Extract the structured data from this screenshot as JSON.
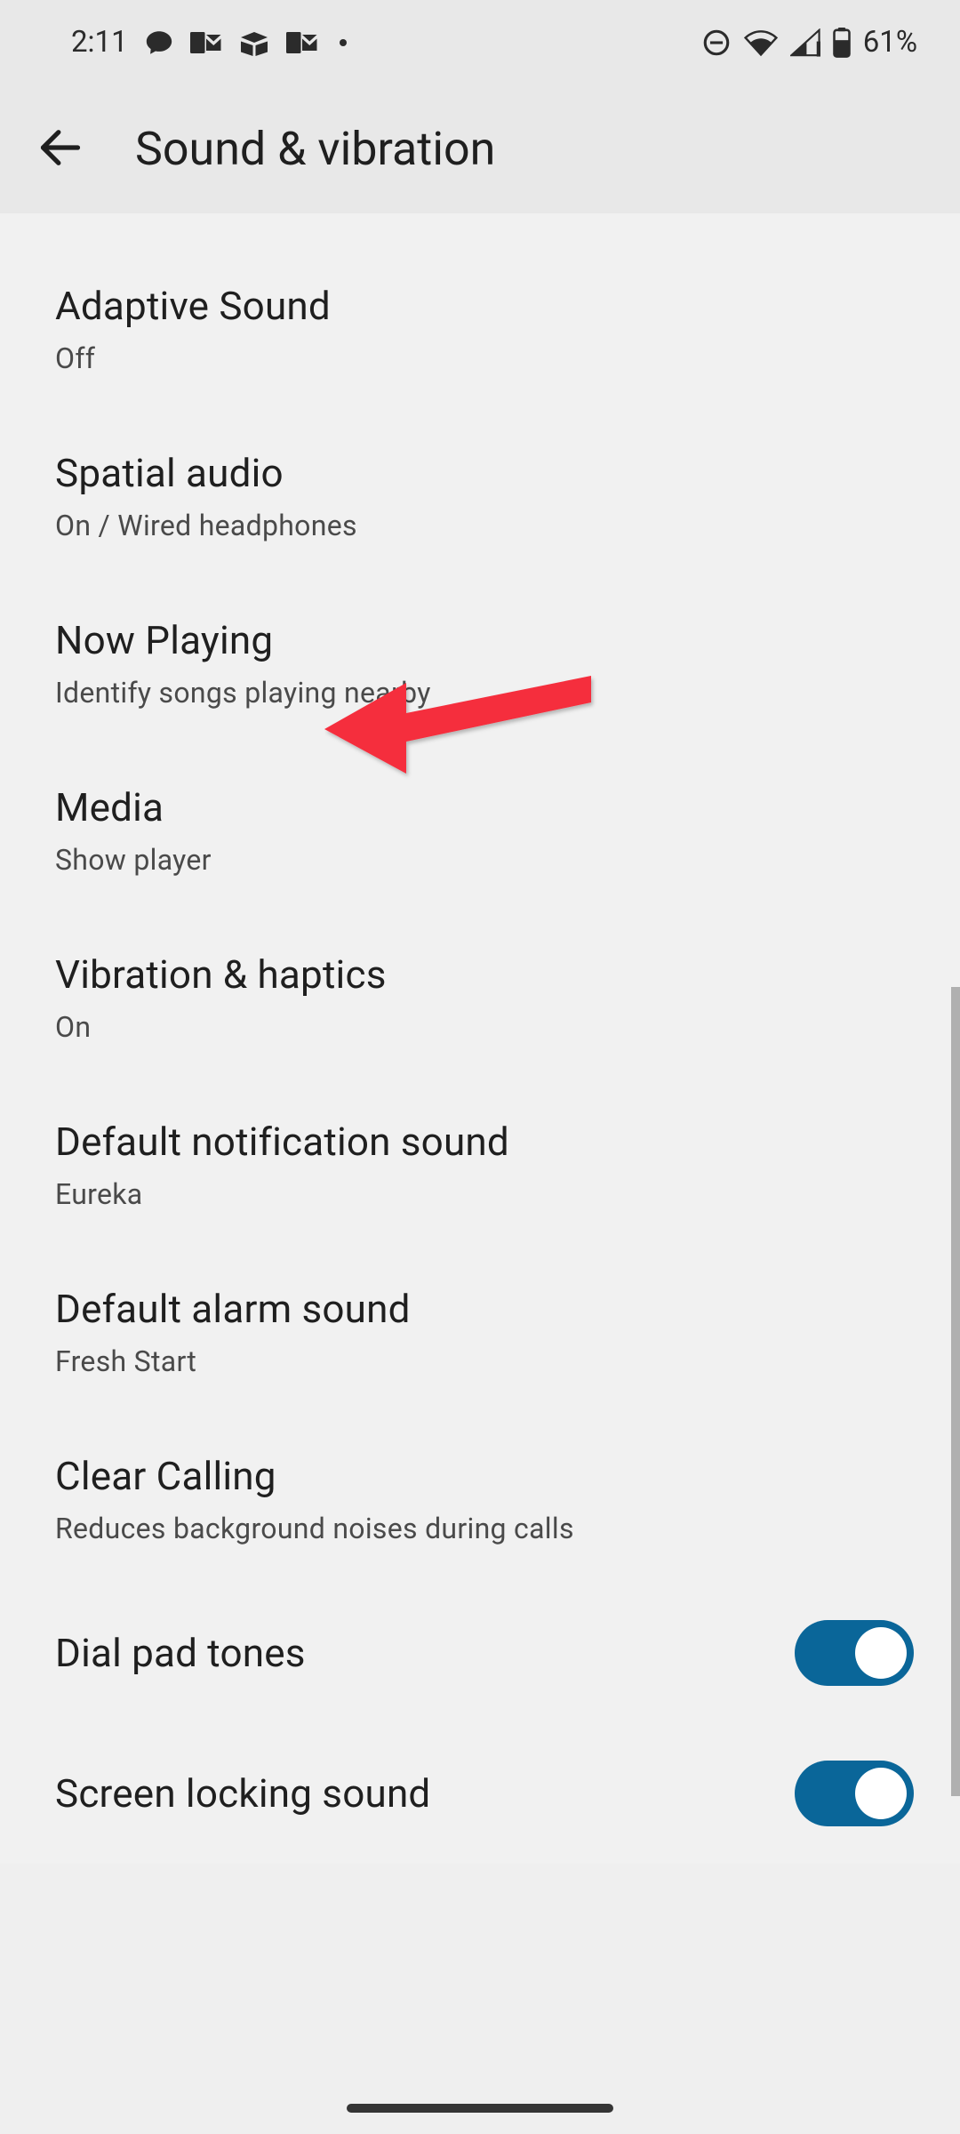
{
  "status": {
    "time": "2:11",
    "battery": "61%"
  },
  "appbar": {
    "title": "Sound & vibration"
  },
  "items": [
    {
      "title": "Adaptive Sound",
      "sub": "Off"
    },
    {
      "title": "Spatial audio",
      "sub": "On / Wired headphones"
    },
    {
      "title": "Now Playing",
      "sub": "Identify songs playing nearby"
    },
    {
      "title": "Media",
      "sub": "Show player"
    },
    {
      "title": "Vibration & haptics",
      "sub": "On"
    },
    {
      "title": "Default notification sound",
      "sub": "Eureka"
    },
    {
      "title": "Default alarm sound",
      "sub": "Fresh Start"
    },
    {
      "title": "Clear Calling",
      "sub": "Reduces background noises during calls"
    }
  ],
  "toggles": [
    {
      "title": "Dial pad tones",
      "on": true
    },
    {
      "title": "Screen locking sound",
      "on": true
    }
  ]
}
